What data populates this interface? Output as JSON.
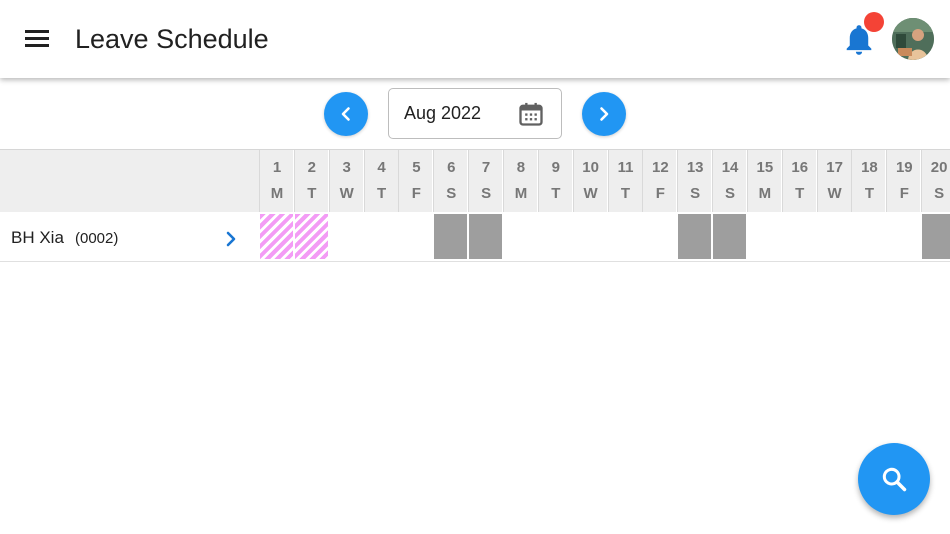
{
  "header": {
    "title": "Leave Schedule",
    "menu_icon": "menu-icon",
    "notification_icon": "bell-icon",
    "has_notification": true,
    "avatar": "user-avatar"
  },
  "month_nav": {
    "prev_icon": "chevron-left-icon",
    "next_icon": "chevron-right-icon",
    "selected_month": "Aug 2022",
    "calendar_icon": "calendar-icon"
  },
  "calendar": {
    "days": [
      {
        "num": "1",
        "wd": "M"
      },
      {
        "num": "2",
        "wd": "T"
      },
      {
        "num": "3",
        "wd": "W"
      },
      {
        "num": "4",
        "wd": "T"
      },
      {
        "num": "5",
        "wd": "F"
      },
      {
        "num": "6",
        "wd": "S"
      },
      {
        "num": "7",
        "wd": "S"
      },
      {
        "num": "8",
        "wd": "M"
      },
      {
        "num": "9",
        "wd": "T"
      },
      {
        "num": "10",
        "wd": "W"
      },
      {
        "num": "11",
        "wd": "T"
      },
      {
        "num": "12",
        "wd": "F"
      },
      {
        "num": "13",
        "wd": "S"
      },
      {
        "num": "14",
        "wd": "S"
      },
      {
        "num": "15",
        "wd": "M"
      },
      {
        "num": "16",
        "wd": "T"
      },
      {
        "num": "17",
        "wd": "W"
      },
      {
        "num": "18",
        "wd": "T"
      },
      {
        "num": "19",
        "wd": "F"
      },
      {
        "num": "20",
        "wd": "S"
      }
    ],
    "employees": [
      {
        "name": "BH Xia",
        "code": "(0002)",
        "leave_days": [
          1,
          2
        ],
        "weekend_days": [
          6,
          7,
          13,
          14,
          20
        ]
      }
    ]
  },
  "fab": {
    "icon": "search-icon"
  },
  "colors": {
    "accent": "#2196f3",
    "leave": "#f39cf5",
    "weekend": "#9e9e9e",
    "badge": "#f44336"
  }
}
